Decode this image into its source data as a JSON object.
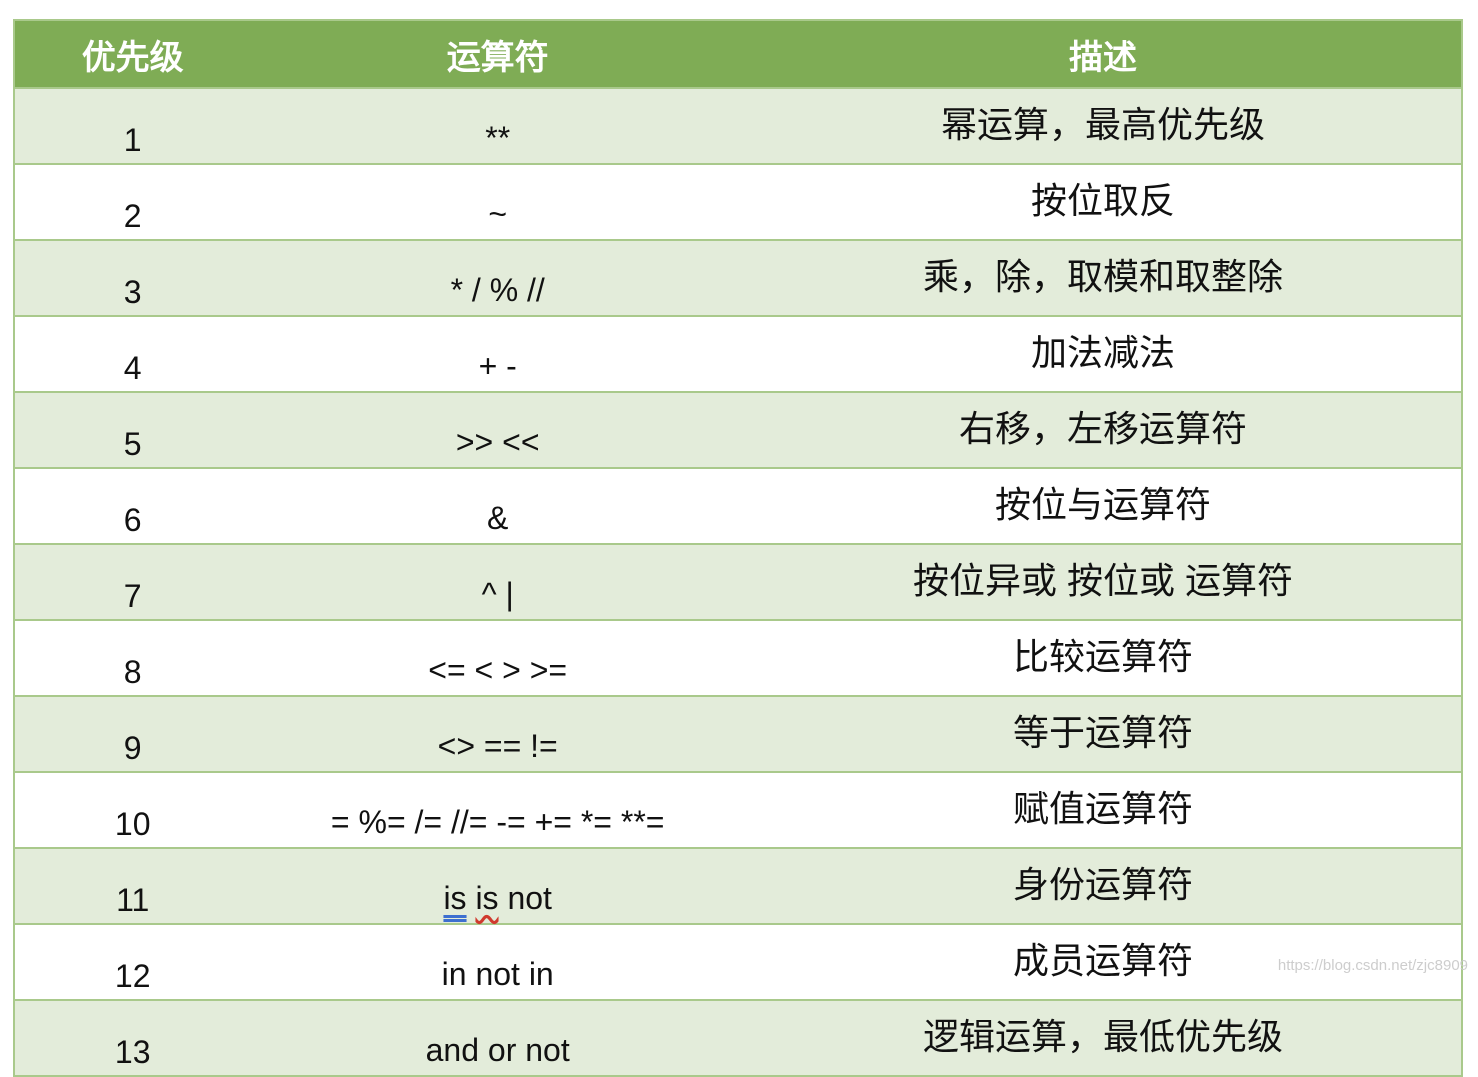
{
  "table": {
    "headers": [
      "优先级",
      "运算符",
      "描述"
    ],
    "rows": [
      {
        "priority": "1",
        "operators": "**",
        "description": "幂运算，最高优先级"
      },
      {
        "priority": "2",
        "operators": "~",
        "description": "按位取反"
      },
      {
        "priority": "3",
        "operators": "* / % //",
        "description": "乘，除，取模和取整除"
      },
      {
        "priority": "4",
        "operators": "+ -",
        "description": "加法减法"
      },
      {
        "priority": "5",
        "operators": ">> <<",
        "description": "右移，左移运算符"
      },
      {
        "priority": "6",
        "operators": "&",
        "description": "按位与运算符"
      },
      {
        "priority": "7",
        "operators": "^ |",
        "description": "按位异或 按位或 运算符"
      },
      {
        "priority": "8",
        "operators": "<= < > >=",
        "description": "比较运算符"
      },
      {
        "priority": "9",
        "operators": "<> == !=",
        "description": "等于运算符"
      },
      {
        "priority": "10",
        "operators": "= %= /= //= -= += *= **=",
        "description": "赋值运算符"
      },
      {
        "priority": "11",
        "operators_parts": [
          "is",
          "is",
          "not"
        ],
        "description": "身份运算符"
      },
      {
        "priority": "12",
        "operators": "in not in",
        "description": "成员运算符"
      },
      {
        "priority": "13",
        "operators": "and or not",
        "description": "逻辑运算，最低优先级"
      }
    ]
  },
  "watermark": "https://blog.csdn.net/zjc8909",
  "colors": {
    "header_bg": "#7fac55",
    "alt_row_bg": "#e3ecda",
    "border": "#a9c98b"
  }
}
